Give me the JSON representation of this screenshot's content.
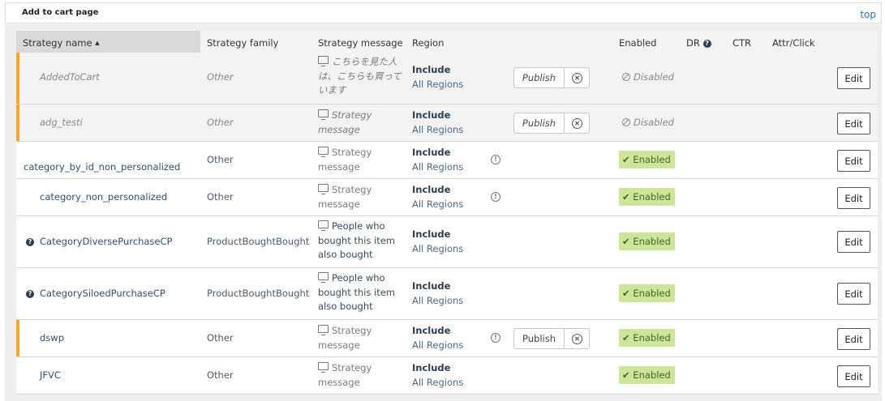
{
  "page": {
    "title": "Add to cart page",
    "top_link": "top"
  },
  "table": {
    "headers": {
      "name": "Strategy name",
      "sort_indicator": "▲",
      "family": "Strategy family",
      "message": "Strategy message",
      "region": "Region",
      "enabled": "Enabled",
      "dr": "DR",
      "ctr": "CTR",
      "attr": "Attr/Click"
    },
    "rows": [
      {
        "name": "AddedToCart",
        "family": "Other",
        "message": "こちらを見た人は、こちらも買っています",
        "region_mode": "Include",
        "region_value": "All Regions",
        "publish": "Publish",
        "status": "Disabled",
        "edit": "Edit"
      },
      {
        "name": "adg_testi",
        "family": "Other",
        "message": "Strategy message",
        "region_mode": "Include",
        "region_value": "All Regions",
        "publish": "Publish",
        "status": "Disabled",
        "edit": "Edit"
      },
      {
        "name": "category_by_id_non_personalized",
        "family": "Other",
        "message": "Strategy message",
        "region_mode": "Include",
        "region_value": "All Regions",
        "status": "Enabled",
        "edit": "Edit"
      },
      {
        "name": "category_non_personalized",
        "family": "Other",
        "message": "Strategy message",
        "region_mode": "Include",
        "region_value": "All Regions",
        "status": "Enabled",
        "edit": "Edit"
      },
      {
        "name": "CategoryDiversePurchaseCP",
        "family": "ProductBoughtBought",
        "message": "People who bought this item also bought",
        "region_mode": "Include",
        "region_value": "All Regions",
        "status": "Enabled",
        "edit": "Edit"
      },
      {
        "name": "CategorySiloedPurchaseCP",
        "family": "ProductBoughtBought",
        "message": "People who bought this item also bought",
        "region_mode": "Include",
        "region_value": "All Regions",
        "status": "Enabled",
        "edit": "Edit"
      },
      {
        "name": "dswp",
        "family": "Other",
        "message": "Strategy message",
        "region_mode": "Include",
        "region_value": "All Regions",
        "publish": "Publish",
        "status": "Enabled",
        "edit": "Edit"
      },
      {
        "name": "JFVC",
        "family": "Other",
        "message": "Strategy message",
        "region_mode": "Include",
        "region_value": "All Regions",
        "status": "Enabled",
        "edit": "Edit"
      }
    ]
  },
  "colors": {
    "pending_flag": "#f7a823",
    "enabled_badge_bg": "#cde59b",
    "enabled_badge_text": "#3e6a1f",
    "link": "#2a7ab0"
  },
  "icons": {
    "message": "monitor-icon",
    "warning": "exclamation-circle-icon",
    "help": "question-circle-icon",
    "unpublish": "x-circle-icon",
    "disabled": "ban-icon",
    "enabled": "check-icon"
  }
}
